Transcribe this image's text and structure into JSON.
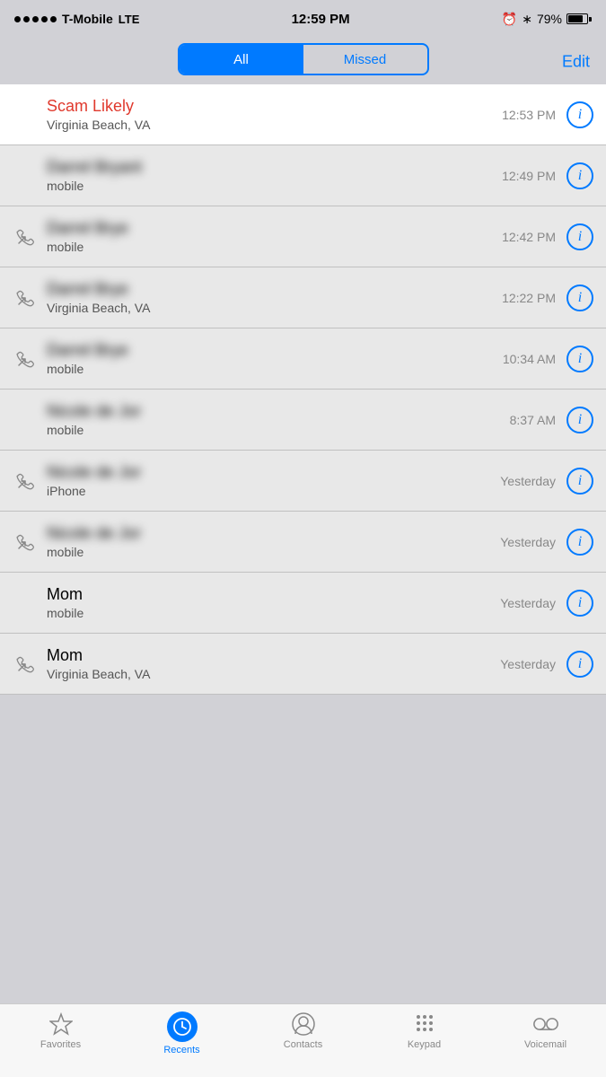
{
  "statusBar": {
    "carrier": "T-Mobile",
    "network": "LTE",
    "time": "12:59 PM",
    "battery": "79%"
  },
  "segmented": {
    "allLabel": "All",
    "missedLabel": "Missed",
    "editLabel": "Edit",
    "activeTab": "All"
  },
  "calls": [
    {
      "id": 1,
      "name": "Scam Likely",
      "sub": "Virginia Beach, VA",
      "time": "12:53 PM",
      "highlighted": true,
      "scam": true,
      "blurred": false,
      "hasIcon": false,
      "iconType": "none"
    },
    {
      "id": 2,
      "name": "Darrel Bryant",
      "sub": "mobile",
      "time": "12:49 PM",
      "highlighted": false,
      "scam": false,
      "blurred": true,
      "hasIcon": false,
      "iconType": "none"
    },
    {
      "id": 3,
      "name": "Darrel Brye",
      "sub": "mobile",
      "time": "12:42 PM",
      "highlighted": false,
      "scam": false,
      "blurred": true,
      "hasIcon": true,
      "iconType": "outgoing"
    },
    {
      "id": 4,
      "name": "Darrel Brye",
      "sub": "Virginia Beach, VA",
      "time": "12:22 PM",
      "highlighted": false,
      "scam": false,
      "blurred": true,
      "hasIcon": true,
      "iconType": "outgoing"
    },
    {
      "id": 5,
      "name": "Darrel Brye",
      "sub": "mobile",
      "time": "10:34 AM",
      "highlighted": false,
      "scam": false,
      "blurred": true,
      "hasIcon": true,
      "iconType": "outgoing"
    },
    {
      "id": 6,
      "name": "Nicole de Jor",
      "sub": "mobile",
      "time": "8:37 AM",
      "highlighted": false,
      "scam": false,
      "blurred": true,
      "hasIcon": false,
      "iconType": "none"
    },
    {
      "id": 7,
      "name": "Nicole de Jor",
      "sub": "iPhone",
      "time": "Yesterday",
      "highlighted": false,
      "scam": false,
      "blurred": true,
      "hasIcon": true,
      "iconType": "outgoing"
    },
    {
      "id": 8,
      "name": "Nicole de Jor",
      "sub": "mobile",
      "time": "Yesterday",
      "highlighted": false,
      "scam": false,
      "blurred": true,
      "hasIcon": true,
      "iconType": "outgoing"
    },
    {
      "id": 9,
      "name": "Mom",
      "sub": "mobile",
      "time": "Yesterday",
      "highlighted": false,
      "scam": false,
      "blurred": false,
      "hasIcon": false,
      "iconType": "none"
    },
    {
      "id": 10,
      "name": "Mom",
      "sub": "Virginia Beach, VA",
      "time": "Yesterday",
      "highlighted": false,
      "scam": false,
      "blurred": false,
      "hasIcon": true,
      "iconType": "outgoing"
    }
  ],
  "tabBar": {
    "tabs": [
      {
        "id": "favorites",
        "label": "Favorites",
        "icon": "star"
      },
      {
        "id": "recents",
        "label": "Recents",
        "icon": "clock",
        "active": true
      },
      {
        "id": "contacts",
        "label": "Contacts",
        "icon": "person"
      },
      {
        "id": "keypad",
        "label": "Keypad",
        "icon": "keypad"
      },
      {
        "id": "voicemail",
        "label": "Voicemail",
        "icon": "voicemail"
      }
    ]
  }
}
